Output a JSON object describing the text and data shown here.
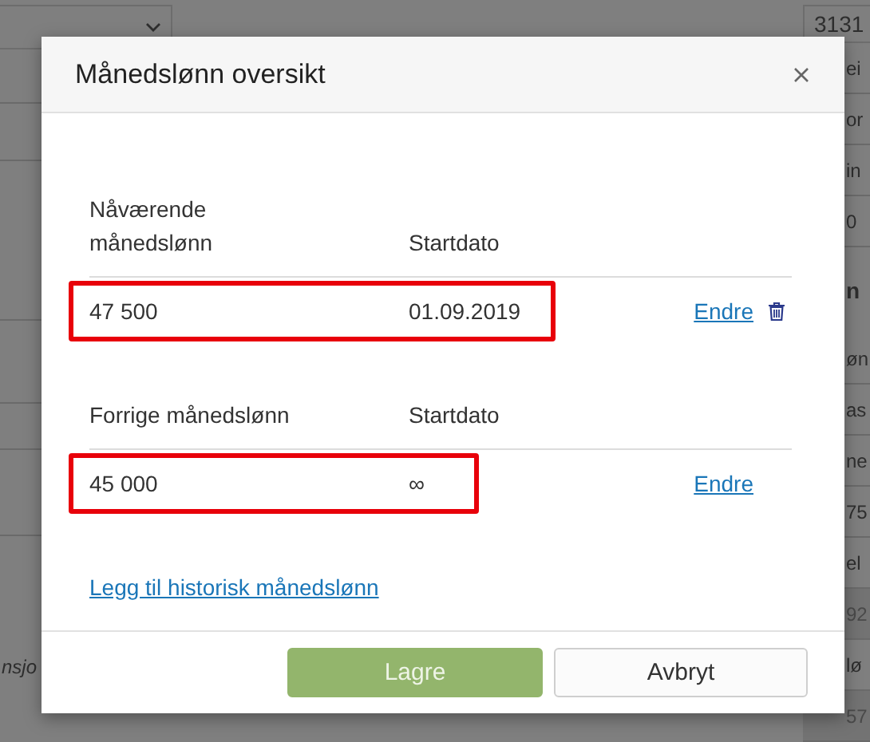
{
  "background": {
    "left_fragments": [
      {
        "text": "nsjo"
      }
    ],
    "right_field": "3131",
    "right_rows": [
      {
        "text": "ei",
        "kind": "plain"
      },
      {
        "text": "or",
        "kind": "plain"
      },
      {
        "text": "in",
        "kind": "plain"
      },
      {
        "text": "0",
        "kind": "plain"
      },
      {
        "text": "n",
        "kind": "heading"
      },
      {
        "text": "øn",
        "kind": "plain"
      },
      {
        "text": "as",
        "kind": "plain"
      },
      {
        "text": "ne",
        "kind": "plain"
      },
      {
        "text": "75",
        "kind": "plain"
      },
      {
        "text": "el",
        "kind": "plain"
      },
      {
        "text": "92",
        "kind": "shaded"
      },
      {
        "text": "lø",
        "kind": "plain"
      },
      {
        "text": "57",
        "kind": "shaded"
      }
    ]
  },
  "dialog": {
    "title": "Månedslønn oversikt",
    "sections": [
      {
        "headers": [
          "Nåværende månedslønn",
          "Startdato"
        ],
        "rows": [
          {
            "amount": "47 500",
            "start": "01.09.2019",
            "edit": "Endre",
            "deletable": true,
            "highlighted": true
          }
        ]
      },
      {
        "headers": [
          "Forrige månedslønn",
          "Startdato"
        ],
        "rows": [
          {
            "amount": "45 000",
            "start": "∞",
            "edit": "Endre",
            "deletable": false,
            "highlighted": true
          }
        ]
      }
    ],
    "add_link": "Legg til historisk månedslønn",
    "buttons": [
      {
        "label": "Lagre",
        "kind": "primary"
      },
      {
        "label": "Avbryt",
        "kind": "secondary"
      }
    ]
  }
}
